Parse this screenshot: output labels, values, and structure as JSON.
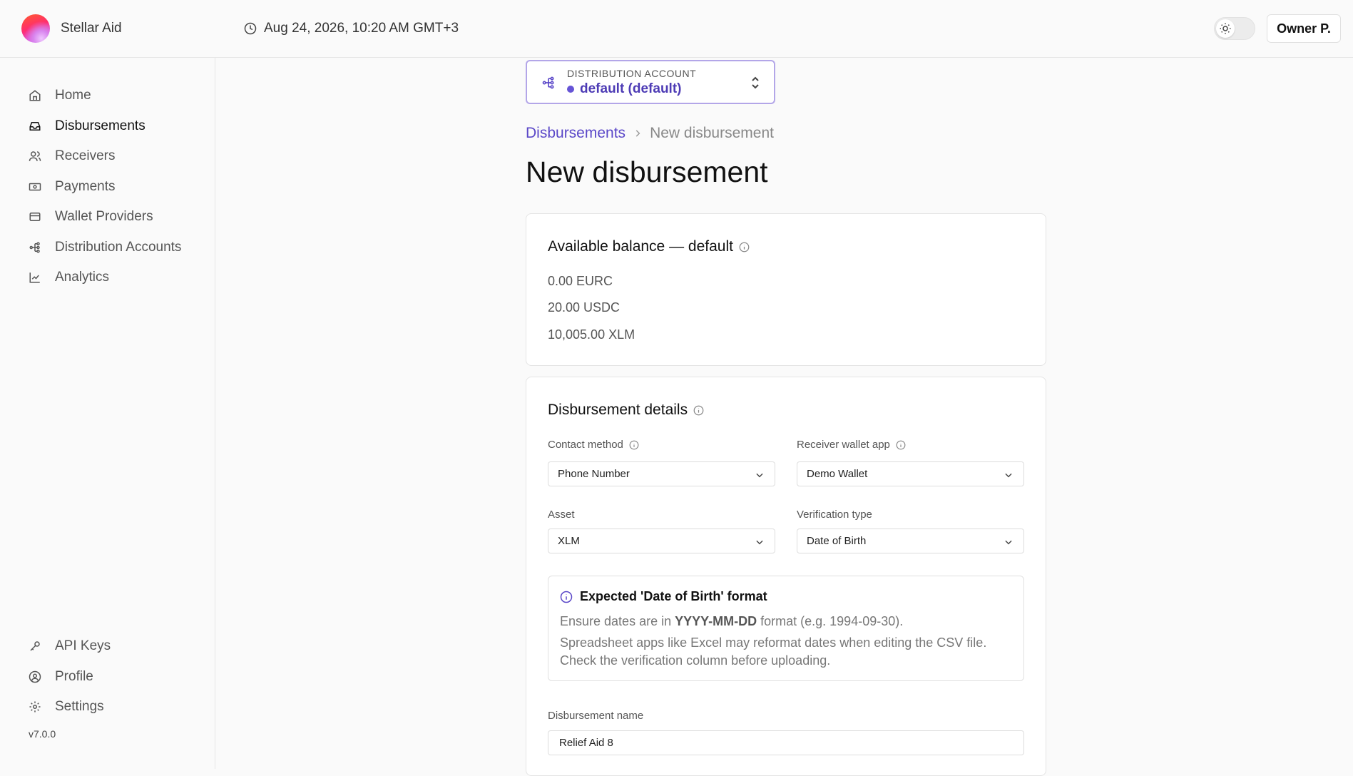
{
  "header": {
    "app_name": "Stellar Aid",
    "datetime": "Aug 24, 2026, 10:20 AM GMT+3",
    "user_button": "Owner P."
  },
  "sidebar": {
    "items": [
      {
        "label": "Home",
        "icon": "home-icon"
      },
      {
        "label": "Disbursements",
        "icon": "inbox-icon",
        "active": true
      },
      {
        "label": "Receivers",
        "icon": "users-icon"
      },
      {
        "label": "Payments",
        "icon": "banknote-icon"
      },
      {
        "label": "Wallet Providers",
        "icon": "wallet-icon"
      },
      {
        "label": "Distribution Accounts",
        "icon": "network-icon"
      },
      {
        "label": "Analytics",
        "icon": "line-chart-icon"
      }
    ],
    "bottom_items": [
      {
        "label": "API Keys",
        "icon": "key-icon"
      },
      {
        "label": "Profile",
        "icon": "user-circle-icon"
      },
      {
        "label": "Settings",
        "icon": "gear-icon"
      }
    ],
    "version": "v7.0.0"
  },
  "account_selector": {
    "label": "DISTRIBUTION ACCOUNT",
    "value": "default (default)"
  },
  "breadcrumb": {
    "parent": "Disbursements",
    "current": "New disbursement"
  },
  "page_title": "New disbursement",
  "balance_card": {
    "title": "Available balance — default",
    "balances": [
      "0.00 EURC",
      "20.00 USDC",
      "10,005.00 XLM"
    ]
  },
  "details_card": {
    "title": "Disbursement details",
    "contact_method": {
      "label": "Contact method",
      "value": "Phone Number"
    },
    "wallet_app": {
      "label": "Receiver wallet app",
      "value": "Demo Wallet"
    },
    "asset": {
      "label": "Asset",
      "value": "XLM"
    },
    "verification": {
      "label": "Verification type",
      "value": "Date of Birth"
    },
    "info": {
      "title": "Expected 'Date of Birth' format",
      "line1_pre": "Ensure dates are in ",
      "line1_bold": "YYYY-MM-DD",
      "line1_post": " format (e.g. 1994-09-30).",
      "line2": "Spreadsheet apps like Excel may reformat dates when editing the CSV file. Check the verification column before uploading."
    },
    "name": {
      "label": "Disbursement name",
      "value": "Relief Aid 8"
    }
  },
  "colors": {
    "accent": "#5a47c8",
    "accent_border": "#b3a6e8"
  }
}
